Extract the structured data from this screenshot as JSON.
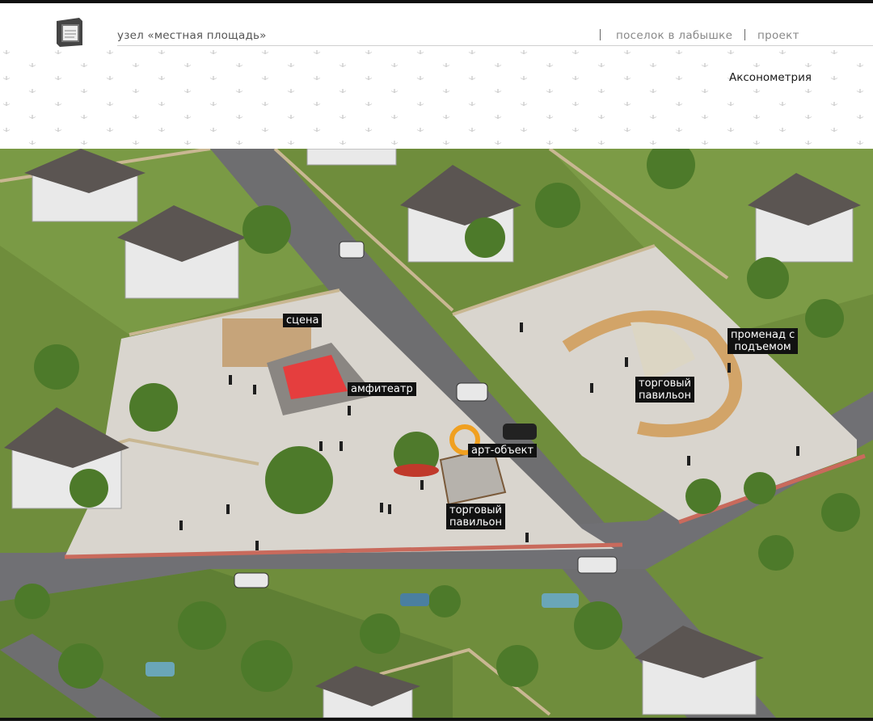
{
  "header": {
    "title": "узел «местная площадь»",
    "nav": [
      "поселок в лабышке",
      "проект"
    ]
  },
  "section_title": "Аксонометрия",
  "map_labels": {
    "stage": "сцена",
    "amphitheatre": "амфитеатр",
    "art_object": "арт-объект",
    "pavilion_1_line1": "торговый",
    "pavilion_1_line2": "павильон",
    "pavilion_2_line1": "торговый",
    "pavilion_2_line2": "павильон",
    "promenade_line1": "променад с",
    "promenade_line2": "подъемом"
  },
  "colors": {
    "accent": "#e53e3e",
    "lawn": "#6f8d3c",
    "plaza": "#d7d3cc",
    "road": "#6e6e70",
    "label_bg": "#111111"
  }
}
